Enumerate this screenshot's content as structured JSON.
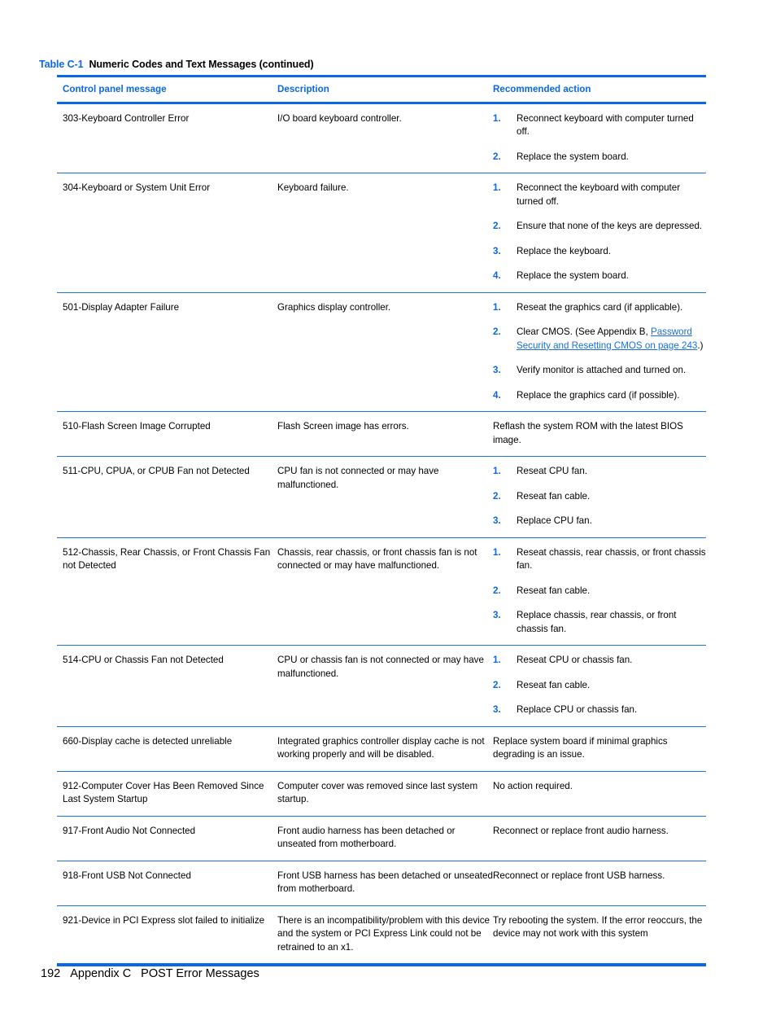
{
  "caption": {
    "label": "Table C-1",
    "title": "Numeric Codes and Text Messages (continued)"
  },
  "table": {
    "headers": {
      "col1": "Control panel message",
      "col2": "Description",
      "col3": "Recommended action"
    },
    "rows": [
      {
        "message": "303-Keyboard Controller Error",
        "description": "I/O board keyboard controller.",
        "steps": [
          {
            "num": "1.",
            "text": "Reconnect keyboard with computer turned off."
          },
          {
            "num": "2.",
            "text": "Replace the system board."
          }
        ]
      },
      {
        "message": "304-Keyboard or System Unit Error",
        "description": "Keyboard failure.",
        "steps": [
          {
            "num": "1.",
            "text": "Reconnect the keyboard with computer turned off."
          },
          {
            "num": "2.",
            "text": "Ensure that none of the keys are depressed."
          },
          {
            "num": "3.",
            "text": "Replace the keyboard."
          },
          {
            "num": "4.",
            "text": "Replace the system board."
          }
        ]
      },
      {
        "message": "501-Display Adapter Failure",
        "description": "Graphics display controller.",
        "steps": [
          {
            "num": "1.",
            "text": "Reseat the graphics card (if applicable)."
          },
          {
            "num": "2.",
            "text_before": "Clear CMOS. (See Appendix B, ",
            "link": "Password Security and Resetting CMOS on page 243",
            "text_after": ".)"
          },
          {
            "num": "3.",
            "text": "Verify monitor is attached and turned on."
          },
          {
            "num": "4.",
            "text": "Replace the graphics card (if possible)."
          }
        ]
      },
      {
        "message": "510-Flash Screen Image Corrupted",
        "description": "Flash Screen image has errors.",
        "action": "Reflash the system ROM with the latest BIOS image."
      },
      {
        "message": "511-CPU, CPUA, or CPUB Fan not Detected",
        "description": "CPU fan is not connected or may have malfunctioned.",
        "steps": [
          {
            "num": "1.",
            "text": "Reseat CPU fan."
          },
          {
            "num": "2.",
            "text": "Reseat fan cable."
          },
          {
            "num": "3.",
            "text": "Replace CPU fan."
          }
        ]
      },
      {
        "message": "512-Chassis, Rear Chassis, or Front Chassis Fan not Detected",
        "description": "Chassis, rear chassis, or front chassis fan is not connected or may have malfunctioned.",
        "steps": [
          {
            "num": "1.",
            "text": "Reseat chassis, rear chassis, or front chassis fan."
          },
          {
            "num": "2.",
            "text": "Reseat fan cable."
          },
          {
            "num": "3.",
            "text": "Replace chassis, rear chassis, or front chassis fan."
          }
        ]
      },
      {
        "message": "514-CPU or Chassis Fan not Detected",
        "description": "CPU or chassis fan is not connected or may have malfunctioned.",
        "steps": [
          {
            "num": "1.",
            "text": "Reseat CPU or chassis fan."
          },
          {
            "num": "2.",
            "text": "Reseat fan cable."
          },
          {
            "num": "3.",
            "text": "Replace CPU or chassis fan."
          }
        ]
      },
      {
        "message": "660-Display cache is detected unreliable",
        "description": "Integrated graphics controller display cache is not working properly and will be disabled.",
        "action": "Replace system board if minimal graphics degrading is an issue."
      },
      {
        "message": "912-Computer Cover Has Been Removed Since Last System Startup",
        "description": "Computer cover was removed since last system startup.",
        "action": "No action required."
      },
      {
        "message": "917-Front Audio Not Connected",
        "description": "Front audio harness has been detached or unseated from motherboard.",
        "action": "Reconnect or replace front audio harness."
      },
      {
        "message": "918-Front USB Not Connected",
        "description": "Front USB harness has been detached or unseated from motherboard.",
        "action": "Reconnect or replace front USB harness."
      },
      {
        "message": "921-Device in PCI Express slot failed to initialize",
        "description": "There is an incompatibility/problem with this device and the system or PCI Express Link could not be retrained to an x1.",
        "action": "Try rebooting the system. If the error reoccurs, the device may not work with this system"
      }
    ]
  },
  "footer": {
    "page_number": "192",
    "appendix": "Appendix C",
    "section": "POST Error Messages"
  },
  "colors": {
    "accent_blue": "#0a68e8",
    "link_blue": "#1a6fe0"
  }
}
